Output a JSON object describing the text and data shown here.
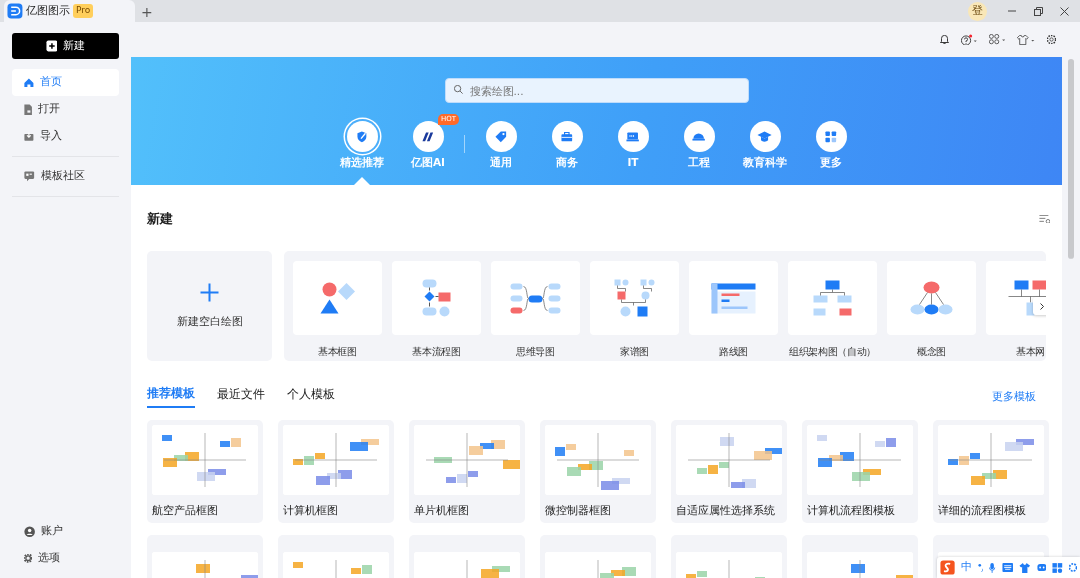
{
  "app_tab": {
    "title": "亿图图示",
    "badge": "Pro"
  },
  "new_tab": "+",
  "avatar": "登",
  "sidebar": {
    "new_button": "新建",
    "items": [
      {
        "label": "首页",
        "kind": "home",
        "selected": true
      },
      {
        "label": "打开",
        "kind": "open",
        "selected": false
      },
      {
        "label": "导入",
        "kind": "import",
        "selected": false
      },
      {
        "label": "模板社区",
        "kind": "community",
        "selected": false
      }
    ],
    "bottom_items": [
      {
        "label": "账户",
        "kind": "account"
      },
      {
        "label": "选项",
        "kind": "settings"
      }
    ]
  },
  "search": {
    "placeholder": "搜索绘图..."
  },
  "categories": [
    {
      "label": "精选推荐",
      "kind": "featured",
      "selected": true
    },
    {
      "label": "亿图AI",
      "kind": "ai",
      "selected": false,
      "badge": "HOT"
    },
    {
      "label": "通用",
      "kind": "tag",
      "selected": false
    },
    {
      "label": "商务",
      "kind": "briefcase",
      "selected": false
    },
    {
      "label": "IT",
      "kind": "monitor",
      "selected": false
    },
    {
      "label": "工程",
      "kind": "helmet",
      "selected": false
    },
    {
      "label": "教育科学",
      "kind": "cap",
      "selected": false
    },
    {
      "label": "更多",
      "kind": "grid",
      "selected": false
    }
  ],
  "new_section": {
    "title": "新建",
    "blank": "新建空白绘图",
    "diagram_types": [
      {
        "label": "基本框图",
        "kind": "basic"
      },
      {
        "label": "基本流程图",
        "kind": "flow"
      },
      {
        "label": "思维导图",
        "kind": "mind"
      },
      {
        "label": "家谱图",
        "kind": "family"
      },
      {
        "label": "路线图",
        "kind": "route"
      },
      {
        "label": "组织架构图（自动）",
        "kind": "org"
      },
      {
        "label": "概念图",
        "kind": "concept"
      },
      {
        "label": "基本网",
        "kind": "network"
      }
    ]
  },
  "template_tabs": [
    {
      "label": "推荐模板",
      "selected": true
    },
    {
      "label": "最近文件",
      "selected": false
    },
    {
      "label": "个人模板",
      "selected": false
    }
  ],
  "more_templates": "更多模板",
  "templates": [
    {
      "title": "航空产品框图"
    },
    {
      "title": "计算机框图"
    },
    {
      "title": "单片机框图"
    },
    {
      "title": "微控制器框图"
    },
    {
      "title": "自适应属性选择系统"
    },
    {
      "title": "计算机流程图模板"
    },
    {
      "title": "详细的流程图模板"
    }
  ],
  "ime_toolbar": {
    "mode": "中"
  }
}
